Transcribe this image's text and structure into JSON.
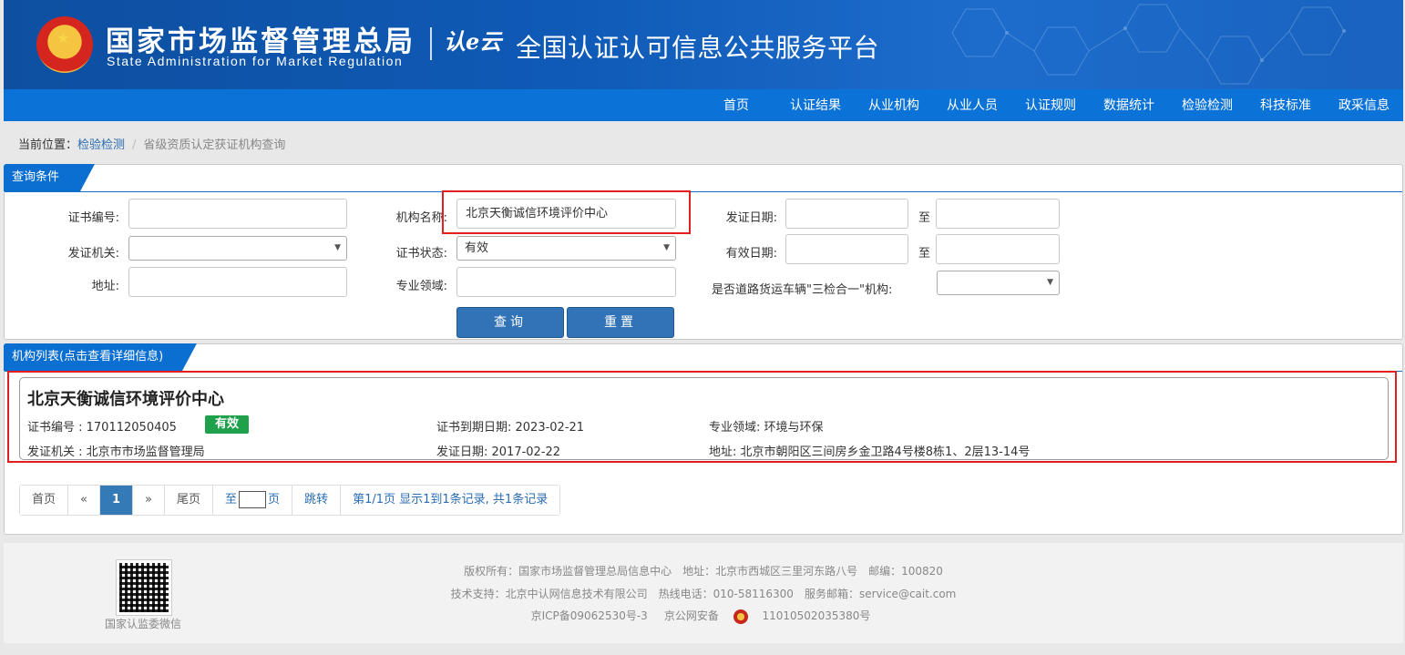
{
  "header": {
    "site_name": "国家市场监督管理总局",
    "site_name_en": "State Administration  for  Market Regulation",
    "logo_text": "认e云",
    "platform_title": "全国认证认可信息公共服务平台"
  },
  "nav": {
    "items": [
      "首页",
      "认证结果",
      "从业机构",
      "从业人员",
      "认证规则",
      "数据统计",
      "检验检测",
      "科技标准",
      "政采信息"
    ]
  },
  "breadcrumb": {
    "prefix": "当前位置：",
    "level1": "检验检测",
    "level2": "省级资质认定获证机构查询"
  },
  "query": {
    "tab_title": "查询条件",
    "cert_no_label": "证书编号:",
    "cert_no_value": "",
    "org_name_label": "机构名称:",
    "org_name_value": "北京天衡诚信环境评价中心",
    "issue_date_label": "发证日期:",
    "to_label_1": "至",
    "issuer_label": "发证机关:",
    "issuer_value": "",
    "status_label": "证书状态:",
    "status_value": "有效",
    "valid_date_label": "有效日期:",
    "to_label_2": "至",
    "address_label": "地址:",
    "field_label": "专业领域:",
    "three_in_one_label": "是否道路货运车辆\"三检合一\"机构:",
    "three_in_one_value": "",
    "search_button": "查询",
    "reset_button": "重置"
  },
  "results": {
    "tab_title": "机构列表(点击查看详细信息)",
    "items": [
      {
        "name": "北京天衡诚信环境评价中心",
        "cert_no": "证书编号 : 170112050405",
        "status": "有效",
        "expiry": "证书到期日期: 2023-02-21",
        "field": "专业领域: 环境与环保",
        "issuer": "发证机关 : 北京市市场监督管理局",
        "issue_date": "发证日期: 2017-02-22",
        "address": "地址: 北京市朝阳区三间房乡金卫路4号楼8栋1、2层13-14号"
      }
    ]
  },
  "pager": {
    "first": "首页",
    "prev": "«",
    "current": "1",
    "next": "»",
    "last": "尾页",
    "goto_pre": "至",
    "goto_post": "页",
    "jump": "跳转",
    "summary": "第1/1页  显示1到1条记录, 共1条记录"
  },
  "footer": {
    "qr_caption": "国家认监委微信",
    "copyright": "版权所有：国家市场监督管理总局信息中心",
    "address": "地址：北京市西城区三里河东路八号",
    "postcode": "邮编：100820",
    "support": "技术支持：北京中认网信息技术有限公司",
    "hotline": "热线电话：010-58116300",
    "email": "服务邮箱：service@cait.com",
    "icp": "京ICP备09062530号-3",
    "police": "京公网安备",
    "police_no": "11010502035380号"
  },
  "colors": {
    "header_blue": "#0f5ab6",
    "nav_blue": "#0b73d8",
    "button_blue": "#3173b6",
    "valid_green": "#1fa04a",
    "highlight_red": "#e02020"
  }
}
